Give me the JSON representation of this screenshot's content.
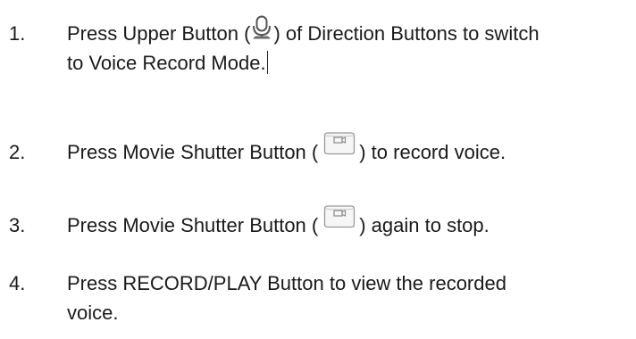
{
  "steps": [
    {
      "number": "1.",
      "line1_before": "Press Upper Button (",
      "icon1": "microphone-icon",
      "line1_after": ") of Direction Buttons to switch",
      "line2": "to Voice Record Mode."
    },
    {
      "number": "2.",
      "before": "Press Movie Shutter Button (",
      "icon": "movie-shutter-icon",
      "after": ") to record voice."
    },
    {
      "number": "3.",
      "before": "Press Movie Shutter Button (",
      "icon": "movie-shutter-icon",
      "after": ") again to stop."
    },
    {
      "number": "4.",
      "line1": "Press RECORD/PLAY Button to view the recorded",
      "line2": "voice."
    }
  ]
}
